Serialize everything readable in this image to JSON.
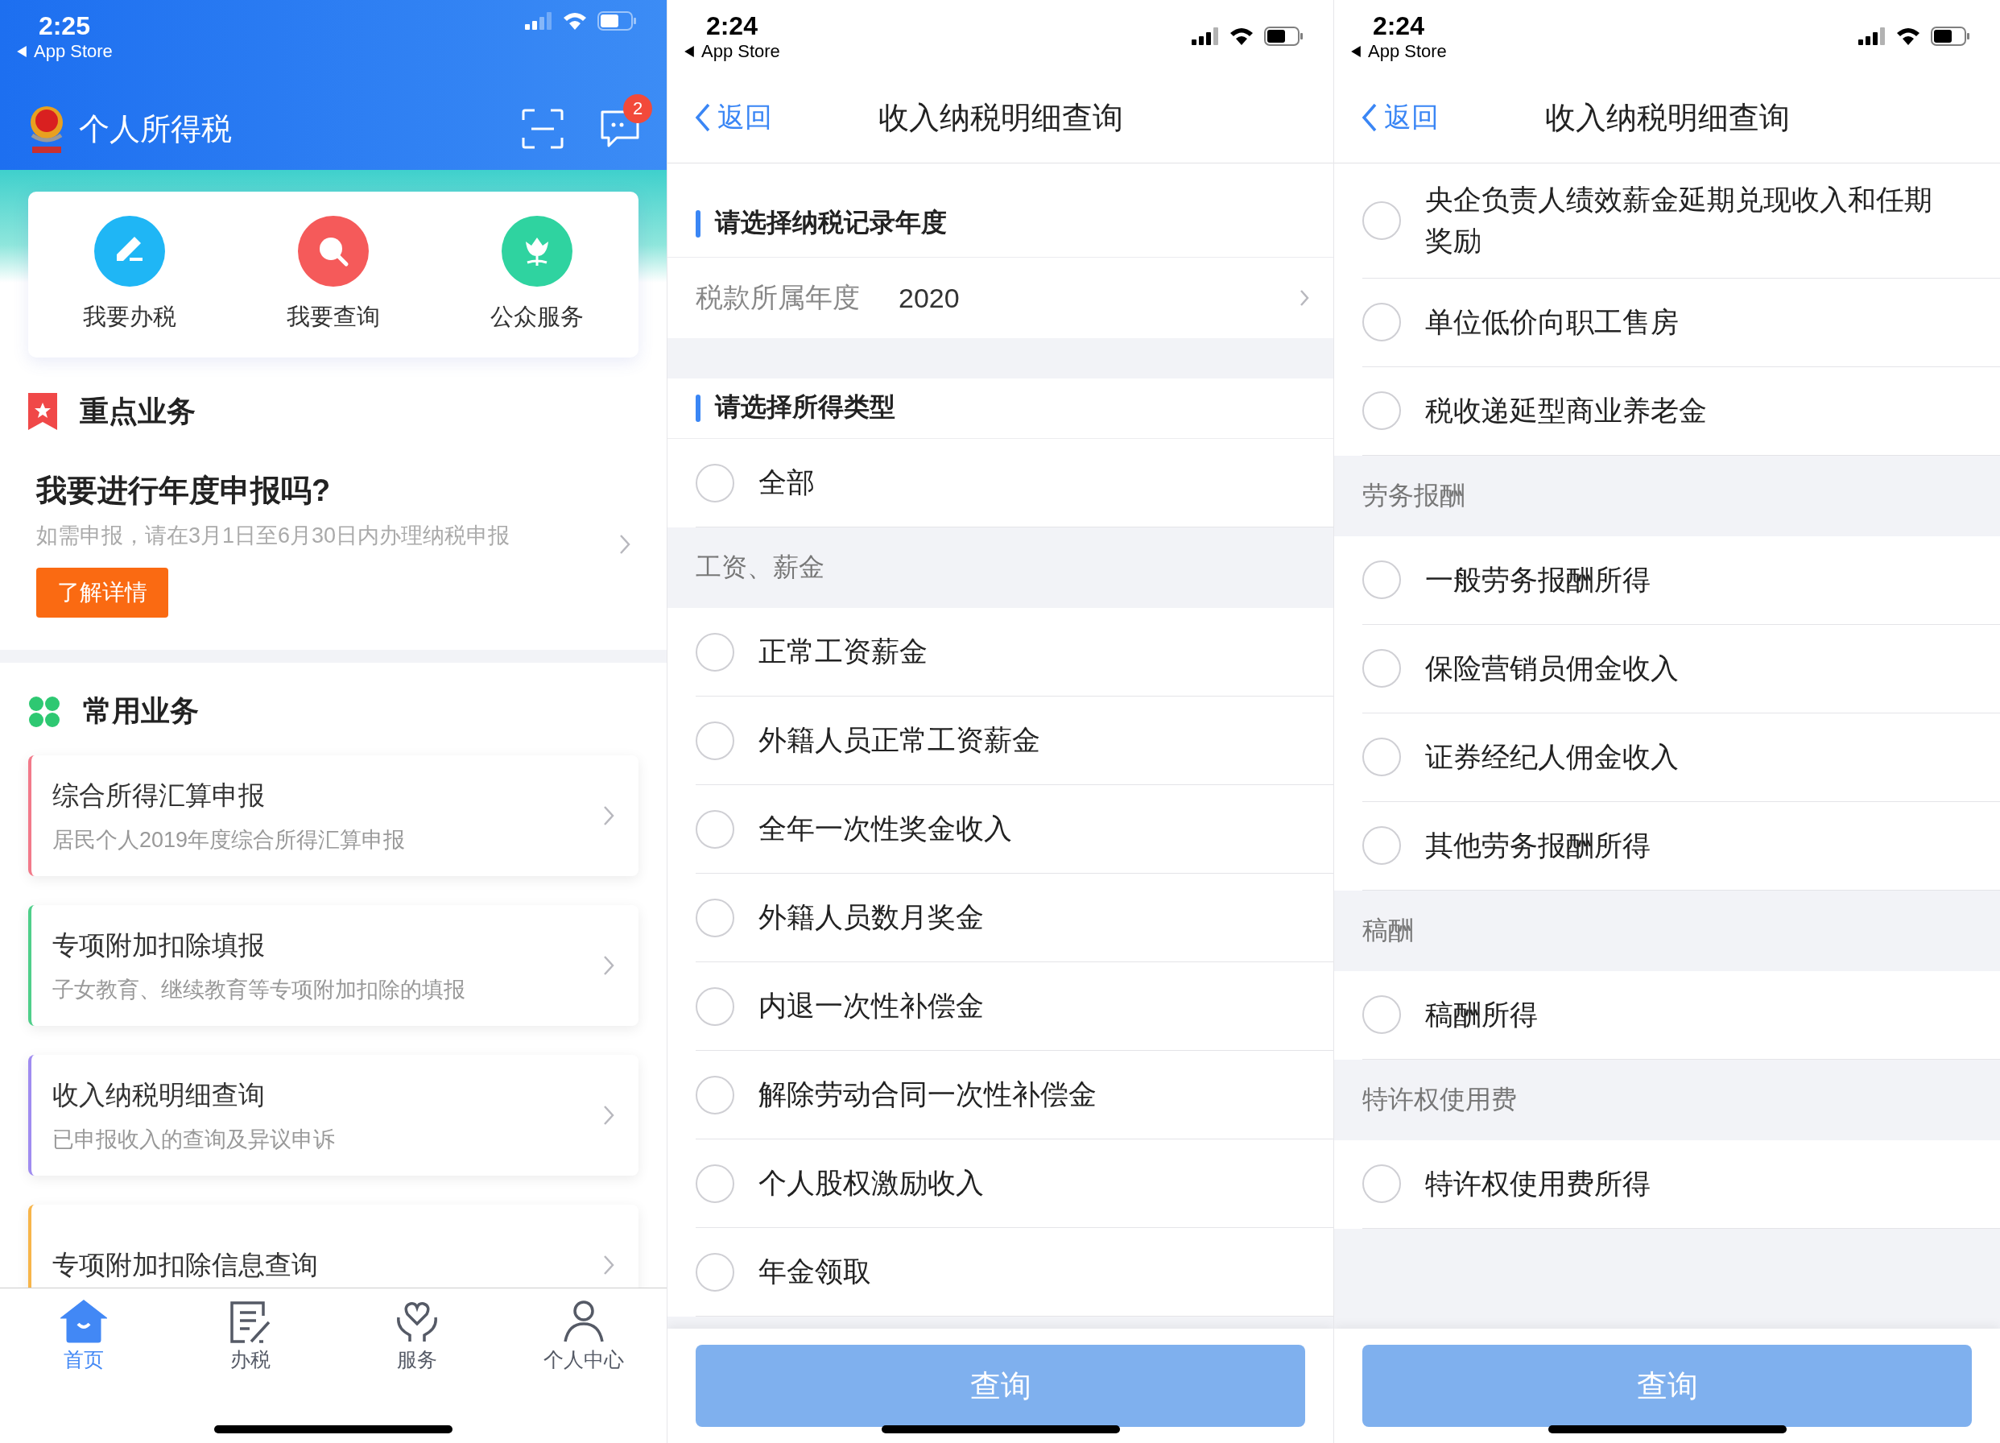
{
  "home_screen": {
    "status_bar": {
      "time": "2:25",
      "back_label": "App Store"
    },
    "header": {
      "title": "个人所得税",
      "message_badge": "2"
    },
    "quick_actions": [
      {
        "label": "我要办税",
        "kind": "pen",
        "color": "#1fb6f5"
      },
      {
        "label": "我要查询",
        "kind": "search",
        "color": "#f55a5a"
      },
      {
        "label": "公众服务",
        "kind": "flower",
        "color": "#2fd3a0"
      }
    ],
    "featured": {
      "heading": "重点业务",
      "title": "我要进行年度申报吗?",
      "subtitle": "如需申报，请在3月1日至6月30日内办理纳税申报",
      "button": "了解详情"
    },
    "common": {
      "heading": "常用业务",
      "items": [
        {
          "title": "综合所得汇算申报",
          "subtitle": "居民个人2019年度综合所得汇算申报",
          "color": "#f27a8a"
        },
        {
          "title": "专项附加扣除填报",
          "subtitle": "子女教育、继续教育等专项附加扣除的填报",
          "color": "#4fcf8a"
        },
        {
          "title": "收入纳税明细查询",
          "subtitle": "已申报收入的查询及异议申诉",
          "color": "#a08cf0"
        },
        {
          "title": "专项附加扣除信息查询",
          "color": "#f7b54a"
        }
      ]
    },
    "tab_bar": [
      {
        "label": "首页",
        "kind": "home",
        "selected": true
      },
      {
        "label": "办税",
        "kind": "form",
        "selected": false
      },
      {
        "label": "服务",
        "kind": "heart",
        "selected": false
      },
      {
        "label": "个人中心",
        "kind": "person",
        "selected": false
      }
    ]
  },
  "query_screens": [
    {
      "status_bar": {
        "time": "2:24",
        "back_label": "App Store"
      },
      "nav": {
        "back": "返回",
        "title": "收入纳税明细查询"
      },
      "entries": [
        {
          "kind": "section",
          "text": "请选择纳税记录年度"
        },
        {
          "kind": "field",
          "label": "税款所属年度",
          "value": "2020"
        },
        {
          "kind": "gap"
        },
        {
          "kind": "section",
          "text": "请选择所得类型"
        },
        {
          "kind": "option",
          "text": "全部",
          "selected": false
        },
        {
          "kind": "group",
          "text": "工资、薪金"
        },
        {
          "kind": "option",
          "text": "正常工资薪金",
          "selected": false
        },
        {
          "kind": "option",
          "text": "外籍人员正常工资薪金",
          "selected": false
        },
        {
          "kind": "option",
          "text": "全年一次性奖金收入",
          "selected": false
        },
        {
          "kind": "option",
          "text": "外籍人员数月奖金",
          "selected": false
        },
        {
          "kind": "option",
          "text": "内退一次性补偿金",
          "selected": false
        },
        {
          "kind": "option",
          "text": "解除劳动合同一次性补偿金",
          "selected": false
        },
        {
          "kind": "option",
          "text": "个人股权激励收入",
          "selected": false
        },
        {
          "kind": "option",
          "text": "年金领取",
          "selected": false
        }
      ],
      "button": {
        "label": "查询",
        "disabled": true
      }
    },
    {
      "status_bar": {
        "time": "2:24",
        "back_label": "App Store"
      },
      "nav": {
        "back": "返回",
        "title": "收入纳税明细查询"
      },
      "entries": [
        {
          "kind": "option",
          "text": "央企负责人绩效薪金延期兑现收入和任期奖励",
          "selected": false
        },
        {
          "kind": "option",
          "text": "单位低价向职工售房",
          "selected": false
        },
        {
          "kind": "option",
          "text": "税收递延型商业养老金",
          "selected": false
        },
        {
          "kind": "group",
          "text": "劳务报酬"
        },
        {
          "kind": "option",
          "text": "一般劳务报酬所得",
          "selected": false
        },
        {
          "kind": "option",
          "text": "保险营销员佣金收入",
          "selected": false
        },
        {
          "kind": "option",
          "text": "证券经纪人佣金收入",
          "selected": false
        },
        {
          "kind": "option",
          "text": "其他劳务报酬所得",
          "selected": false
        },
        {
          "kind": "group",
          "text": "稿酬"
        },
        {
          "kind": "option",
          "text": "稿酬所得",
          "selected": false
        },
        {
          "kind": "group",
          "text": "特许权使用费"
        },
        {
          "kind": "option",
          "text": "特许权使用费所得",
          "selected": false
        }
      ],
      "button": {
        "label": "查询",
        "disabled": true
      }
    }
  ]
}
